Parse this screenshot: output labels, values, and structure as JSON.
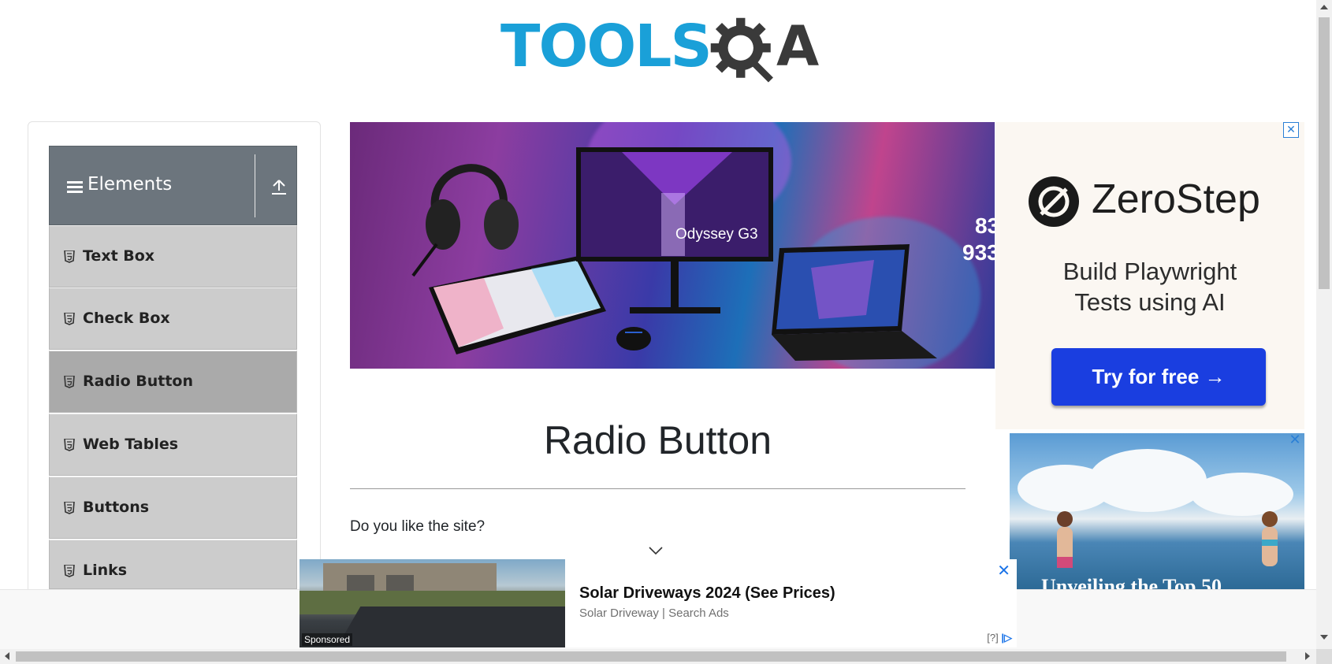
{
  "logo": {
    "text_main": "TOOLS",
    "text_end": "A",
    "brand_blue": "#1aa0d8",
    "brand_dark": "#3a3a3a"
  },
  "sidebar": {
    "group_title": "Elements",
    "group_icon": "hamburger-icon",
    "collapse_icon": "upload-arrow-icon",
    "items": [
      {
        "label": "Text Box",
        "icon": "html5-icon",
        "active": false
      },
      {
        "label": "Check Box",
        "icon": "html5-icon",
        "active": false
      },
      {
        "label": "Radio Button",
        "icon": "html5-icon",
        "active": true
      },
      {
        "label": "Web Tables",
        "icon": "html5-icon",
        "active": false
      },
      {
        "label": "Buttons",
        "icon": "html5-icon",
        "active": false
      },
      {
        "label": "Links",
        "icon": "html5-icon",
        "active": false
      }
    ],
    "colors": {
      "header_bg": "#6c757d",
      "item_bg": "#cccccc",
      "active_bg": "#aaaaaa"
    }
  },
  "banner": {
    "product_label": "Odyssey G3",
    "edge_text_1": "83",
    "edge_text_2": "933"
  },
  "main": {
    "page_title": "Radio Button",
    "question": "Do you like the site?",
    "expand_icon": "chevron-down-icon"
  },
  "ads": {
    "right_top": {
      "brand": "ZeroStep",
      "tagline_line1": "Build Playwright",
      "tagline_line2": "Tests using AI",
      "cta": "Try for free →",
      "cta_color": "#1a3ee0",
      "close_glyph": "✕"
    },
    "right_bottom": {
      "close_glyph": "✕",
      "partial_text": "Unveiling the Top 50"
    },
    "bottom": {
      "headline": "Solar Driveways 2024 (See Prices)",
      "source": "Solar Driveway | Search Ads",
      "sponsored": "Sponsored",
      "close_glyph": "✕",
      "adchoice": "[?]"
    }
  }
}
